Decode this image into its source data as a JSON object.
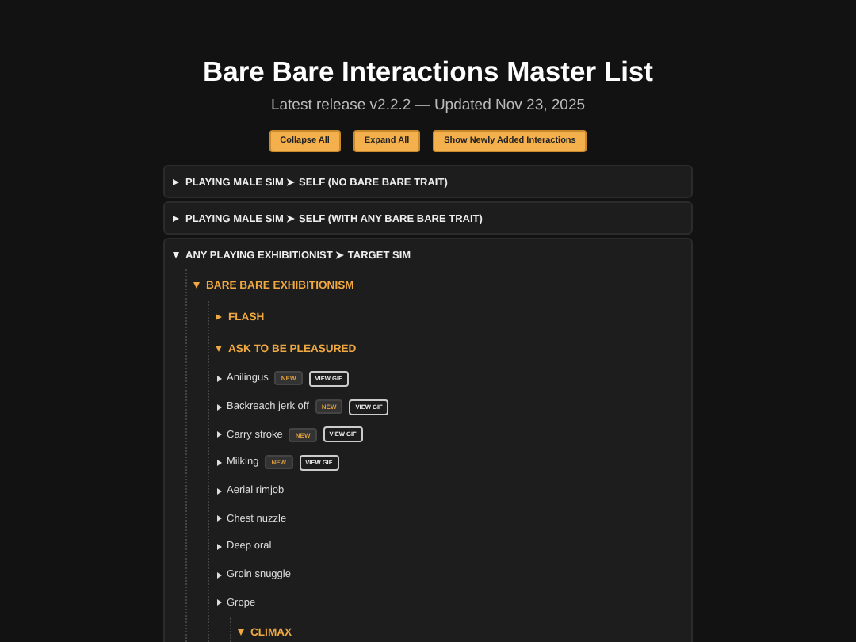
{
  "title": "Bare Bare Interactions Master List",
  "subtitle": "Latest release v2.2.2 — Updated Nov 23, 2025",
  "buttons": [
    "Collapse All",
    "Expand All",
    "Show Newly Added Interactions"
  ],
  "sections": [
    {
      "label": "PLAYING MALE SIM ➤ SELF (NO BARE BARE TRAIT)",
      "expanded": false
    },
    {
      "label": "PLAYING MALE SIM ➤ SELF (WITH ANY BARE BARE TRAIT)",
      "expanded": false
    },
    {
      "label": "ANY PLAYING EXHIBITIONIST ➤ TARGET SIM",
      "expanded": true,
      "children": [
        {
          "label": "BARE BARE EXHIBITIONISM",
          "expanded": true,
          "children": [
            {
              "label": "FLASH",
              "expanded": false
            },
            {
              "label": "ASK TO BE PLEASURED",
              "expanded": true,
              "children": [
                {
                  "kind": "interaction",
                  "label": "Anilingus",
                  "expanded": false,
                  "badges": [
                    {
                      "kind": "new",
                      "text": "NEW"
                    },
                    {
                      "kind": "gif",
                      "text": "VIEW GIF"
                    }
                  ]
                },
                {
                  "kind": "interaction",
                  "label": "Backreach jerk off",
                  "expanded": false,
                  "badges": [
                    {
                      "kind": "new",
                      "text": "NEW"
                    },
                    {
                      "kind": "gif",
                      "text": "VIEW GIF"
                    }
                  ]
                },
                {
                  "kind": "interaction",
                  "label": "Carry stroke",
                  "expanded": false,
                  "badges": [
                    {
                      "kind": "new",
                      "text": "NEW"
                    },
                    {
                      "kind": "gif",
                      "text": "VIEW GIF"
                    }
                  ]
                },
                {
                  "kind": "interaction",
                  "label": "Milking",
                  "expanded": false,
                  "badges": [
                    {
                      "kind": "new",
                      "text": "NEW"
                    },
                    {
                      "kind": "gif",
                      "text": "VIEW GIF"
                    }
                  ]
                },
                {
                  "kind": "interaction",
                  "label": "Aerial rimjob",
                  "expanded": false
                },
                {
                  "kind": "interaction",
                  "label": "Chest nuzzle",
                  "expanded": false
                },
                {
                  "kind": "interaction",
                  "label": "Deep oral",
                  "expanded": false
                },
                {
                  "kind": "interaction",
                  "label": "Groin snuggle",
                  "expanded": false
                },
                {
                  "kind": "interaction",
                  "label": "Grope",
                  "expanded": false
                },
                {
                  "kind": "group",
                  "label": "CLIMAX",
                  "expanded": true
                }
              ]
            }
          ]
        }
      ]
    }
  ]
}
